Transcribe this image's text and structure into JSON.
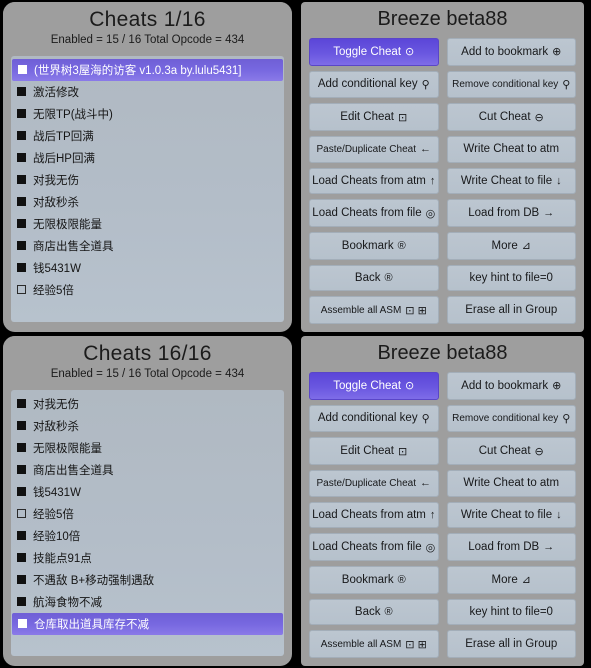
{
  "panels": {
    "cheats_top": {
      "title": "Cheats 1/16",
      "subtitle": "Enabled = 15 / 16  Total Opcode = 434",
      "rows": [
        {
          "label": "(世界树3屋海的访客 v1.0.3a by.lulu5431]",
          "checked": true,
          "selected": true
        },
        {
          "label": "激活修改",
          "checked": true,
          "selected": false
        },
        {
          "label": "无限TP(战斗中)",
          "checked": true,
          "selected": false
        },
        {
          "label": "战后TP回满",
          "checked": true,
          "selected": false
        },
        {
          "label": "战后HP回满",
          "checked": true,
          "selected": false
        },
        {
          "label": "对我无伤",
          "checked": true,
          "selected": false
        },
        {
          "label": "对敌秒杀",
          "checked": true,
          "selected": false
        },
        {
          "label": "无限极限能量",
          "checked": true,
          "selected": false
        },
        {
          "label": "商店出售全道具",
          "checked": true,
          "selected": false
        },
        {
          "label": "钱5431W",
          "checked": true,
          "selected": false
        },
        {
          "label": "经验5倍",
          "checked": false,
          "selected": false
        }
      ]
    },
    "cheats_bottom": {
      "title": "Cheats 16/16",
      "subtitle": "Enabled = 15 / 16  Total Opcode = 434",
      "rows": [
        {
          "label": "对我无伤",
          "checked": true,
          "selected": false
        },
        {
          "label": "对敌秒杀",
          "checked": true,
          "selected": false
        },
        {
          "label": "无限极限能量",
          "checked": true,
          "selected": false
        },
        {
          "label": "商店出售全道具",
          "checked": true,
          "selected": false
        },
        {
          "label": "钱5431W",
          "checked": true,
          "selected": false
        },
        {
          "label": "经验5倍",
          "checked": false,
          "selected": false
        },
        {
          "label": "经验10倍",
          "checked": true,
          "selected": false
        },
        {
          "label": "技能点91点",
          "checked": true,
          "selected": false
        },
        {
          "label": "不遇敌 B+移动强制遇敌",
          "checked": true,
          "selected": false
        },
        {
          "label": "航海食物不减",
          "checked": true,
          "selected": false
        },
        {
          "label": "仓库取出道具库存不减",
          "checked": true,
          "selected": true
        }
      ]
    },
    "breeze_top": {
      "title": "Breeze beta88",
      "buttons": [
        {
          "label": "Toggle Cheat",
          "glyph": "⊙",
          "icon_name": "target-icon",
          "active": true,
          "small": false
        },
        {
          "label": "Add to bookmark",
          "glyph": "⊕",
          "icon_name": "plus-circle-icon",
          "active": false,
          "small": false
        },
        {
          "label": "Add conditional key",
          "glyph": "⚲",
          "icon_name": "key-icon",
          "active": false,
          "small": false
        },
        {
          "label": "Remove conditional key",
          "glyph": "⚲",
          "icon_name": "key-icon",
          "active": false,
          "small": true
        },
        {
          "label": "Edit Cheat",
          "glyph": "⊡",
          "icon_name": "edit-box-icon",
          "active": false,
          "small": false
        },
        {
          "label": "Cut Cheat",
          "glyph": "⊖",
          "icon_name": "minus-circle-icon",
          "active": false,
          "small": false
        },
        {
          "label": "Paste/Duplicate Cheat",
          "glyph": "←",
          "icon_name": "arrow-left-icon",
          "active": false,
          "small": true
        },
        {
          "label": "Write Cheat to atm",
          "glyph": "",
          "icon_name": "",
          "active": false,
          "small": false
        },
        {
          "label": "Load Cheats from atm",
          "glyph": "↑",
          "icon_name": "arrow-up-icon",
          "active": false,
          "small": false
        },
        {
          "label": "Write Cheat to file",
          "glyph": "↓",
          "icon_name": "arrow-down-icon",
          "active": false,
          "small": false
        },
        {
          "label": "Load Cheats from file",
          "glyph": "◎",
          "icon_name": "circle-icon",
          "active": false,
          "small": false
        },
        {
          "label": "Load from DB",
          "glyph": "→",
          "icon_name": "arrow-right-icon",
          "active": false,
          "small": false
        },
        {
          "label": "Bookmark",
          "glyph": "®",
          "icon_name": "r-button-icon",
          "active": false,
          "small": false
        },
        {
          "label": "More",
          "glyph": "⊿",
          "icon_name": "more-icon",
          "active": false,
          "small": false
        },
        {
          "label": "Back",
          "glyph": "®",
          "icon_name": "b-button-icon",
          "active": false,
          "small": false
        },
        {
          "label": "key hint to file=0",
          "glyph": "",
          "icon_name": "",
          "active": false,
          "small": false
        },
        {
          "label": "Assemble all ASM",
          "glyph": "⊡ ⊞",
          "icon_name": "dual-box-icon",
          "active": false,
          "small": true
        },
        {
          "label": "Erase all in Group",
          "glyph": "",
          "icon_name": "",
          "active": false,
          "small": false
        }
      ]
    },
    "breeze_bottom": {
      "title": "Breeze beta88",
      "buttons": [
        {
          "label": "Toggle Cheat",
          "glyph": "⊙",
          "icon_name": "target-icon",
          "active": true,
          "small": false
        },
        {
          "label": "Add to bookmark",
          "glyph": "⊕",
          "icon_name": "plus-circle-icon",
          "active": false,
          "small": false
        },
        {
          "label": "Add conditional key",
          "glyph": "⚲",
          "icon_name": "key-icon",
          "active": false,
          "small": false
        },
        {
          "label": "Remove conditional key",
          "glyph": "⚲",
          "icon_name": "key-icon",
          "active": false,
          "small": true
        },
        {
          "label": "Edit Cheat",
          "glyph": "⊡",
          "icon_name": "edit-box-icon",
          "active": false,
          "small": false
        },
        {
          "label": "Cut Cheat",
          "glyph": "⊖",
          "icon_name": "minus-circle-icon",
          "active": false,
          "small": false
        },
        {
          "label": "Paste/Duplicate Cheat",
          "glyph": "←",
          "icon_name": "arrow-left-icon",
          "active": false,
          "small": true
        },
        {
          "label": "Write Cheat to atm",
          "glyph": "",
          "icon_name": "",
          "active": false,
          "small": false
        },
        {
          "label": "Load Cheats from atm",
          "glyph": "↑",
          "icon_name": "arrow-up-icon",
          "active": false,
          "small": false
        },
        {
          "label": "Write Cheat to file",
          "glyph": "↓",
          "icon_name": "arrow-down-icon",
          "active": false,
          "small": false
        },
        {
          "label": "Load Cheats from file",
          "glyph": "◎",
          "icon_name": "circle-icon",
          "active": false,
          "small": false
        },
        {
          "label": "Load from DB",
          "glyph": "→",
          "icon_name": "arrow-right-icon",
          "active": false,
          "small": false
        },
        {
          "label": "Bookmark",
          "glyph": "®",
          "icon_name": "r-button-icon",
          "active": false,
          "small": false
        },
        {
          "label": "More",
          "glyph": "⊿",
          "icon_name": "more-icon",
          "active": false,
          "small": false
        },
        {
          "label": "Back",
          "glyph": "®",
          "icon_name": "b-button-icon",
          "active": false,
          "small": false
        },
        {
          "label": "key hint to file=0",
          "glyph": "",
          "icon_name": "",
          "active": false,
          "small": false
        },
        {
          "label": "Assemble all ASM",
          "glyph": "⊡ ⊞",
          "icon_name": "dual-box-icon",
          "active": false,
          "small": true
        },
        {
          "label": "Erase all in Group",
          "glyph": "",
          "icon_name": "",
          "active": false,
          "small": false
        }
      ]
    }
  },
  "colors": {
    "panel_header_bg": "#9e9e9e",
    "list_bg": "#b3bdc8",
    "selection": "#7768e0",
    "button_bg": "#b6c1cc",
    "text": "#17181a",
    "background": "#000000"
  }
}
